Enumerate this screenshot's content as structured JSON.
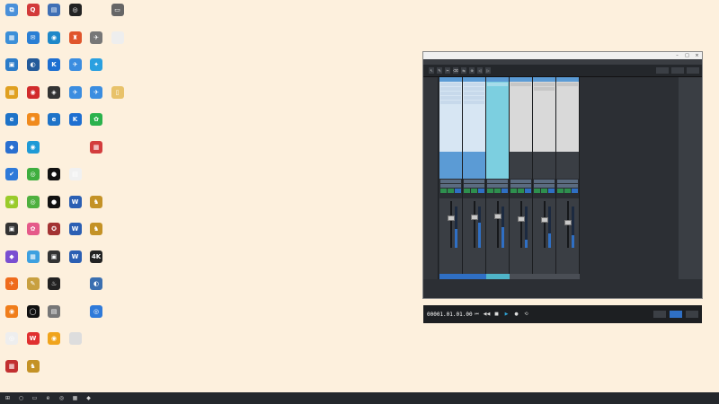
{
  "desktop": {
    "icons": [
      {
        "label": "",
        "glyph": "⧉",
        "color": "#4a90d9",
        "col": 0,
        "row": 0
      },
      {
        "label": "",
        "glyph": "Q",
        "color": "#d23a3a",
        "col": 1,
        "row": 0
      },
      {
        "label": "",
        "glyph": "▤",
        "color": "#3f6fb5",
        "col": 2,
        "row": 0
      },
      {
        "label": "",
        "glyph": "◎",
        "color": "#222222",
        "col": 3,
        "row": 0
      },
      {
        "label": "",
        "glyph": "▭",
        "color": "#666666",
        "col": 5,
        "row": 0
      },
      {
        "label": "",
        "glyph": "▦",
        "color": "#3c8fd8",
        "col": 0,
        "row": 1
      },
      {
        "label": "",
        "glyph": "✉",
        "color": "#2a7fd4",
        "col": 1,
        "row": 1
      },
      {
        "label": "",
        "glyph": "◉",
        "color": "#1e88c9",
        "col": 2,
        "row": 1
      },
      {
        "label": "",
        "glyph": "♜",
        "color": "#e0552b",
        "col": 3,
        "row": 1
      },
      {
        "label": "",
        "glyph": "✈",
        "color": "#777777",
        "col": 4,
        "row": 1
      },
      {
        "label": "",
        "glyph": "",
        "color": "#eeeeee",
        "col": 5,
        "row": 1
      },
      {
        "label": "",
        "glyph": "▣",
        "color": "#2b7cc9",
        "col": 0,
        "row": 2
      },
      {
        "label": "",
        "glyph": "◐",
        "color": "#235a9a",
        "col": 1,
        "row": 2
      },
      {
        "label": "",
        "glyph": "K",
        "color": "#1e6fd1",
        "col": 2,
        "row": 2
      },
      {
        "label": "",
        "glyph": "✈",
        "color": "#3b8de0",
        "col": 3,
        "row": 2
      },
      {
        "label": "",
        "glyph": "✦",
        "color": "#2aa0e0",
        "col": 4,
        "row": 2
      },
      {
        "label": "",
        "glyph": "▦",
        "color": "#e0a020",
        "col": 0,
        "row": 3
      },
      {
        "label": "",
        "glyph": "◉",
        "color": "#d12b2b",
        "col": 1,
        "row": 3
      },
      {
        "label": "",
        "glyph": "◈",
        "color": "#333333",
        "col": 2,
        "row": 3
      },
      {
        "label": "",
        "glyph": "✈",
        "color": "#3b8de0",
        "col": 3,
        "row": 3
      },
      {
        "label": "",
        "glyph": "✈",
        "color": "#3b8de0",
        "col": 4,
        "row": 3
      },
      {
        "label": "",
        "glyph": "▯",
        "color": "#e8c26a",
        "col": 5,
        "row": 3
      },
      {
        "label": "",
        "glyph": "e",
        "color": "#1e73c8",
        "col": 0,
        "row": 4
      },
      {
        "label": "",
        "glyph": "✺",
        "color": "#f08a1d",
        "col": 1,
        "row": 4
      },
      {
        "label": "",
        "glyph": "e",
        "color": "#1e73c8",
        "col": 2,
        "row": 4
      },
      {
        "label": "",
        "glyph": "K",
        "color": "#1e6fd1",
        "col": 3,
        "row": 4
      },
      {
        "label": "",
        "glyph": "✿",
        "color": "#2bb24c",
        "col": 4,
        "row": 4
      },
      {
        "label": "",
        "glyph": "◆",
        "color": "#2a6fd0",
        "col": 0,
        "row": 5
      },
      {
        "label": "",
        "glyph": "◉",
        "color": "#1f9ad6",
        "col": 1,
        "row": 5
      },
      {
        "label": "",
        "glyph": "▦",
        "color": "#d33d3d",
        "col": 4,
        "row": 5
      },
      {
        "label": "",
        "glyph": "✔",
        "color": "#2f7ad9",
        "col": 0,
        "row": 6
      },
      {
        "label": "",
        "glyph": "◎",
        "color": "#3fae3f",
        "col": 1,
        "row": 6
      },
      {
        "label": "",
        "glyph": "●",
        "color": "#111111",
        "col": 2,
        "row": 6
      },
      {
        "label": "",
        "glyph": "▤",
        "color": "#f1f1f1",
        "col": 3,
        "row": 6
      },
      {
        "label": "",
        "glyph": "◉",
        "color": "#9acb2a",
        "col": 0,
        "row": 7
      },
      {
        "label": "",
        "glyph": "◎",
        "color": "#4fb03f",
        "col": 1,
        "row": 7
      },
      {
        "label": "",
        "glyph": "●",
        "color": "#111111",
        "col": 2,
        "row": 7
      },
      {
        "label": "",
        "glyph": "W",
        "color": "#2b5fb3",
        "col": 3,
        "row": 7
      },
      {
        "label": "",
        "glyph": "♞",
        "color": "#c49226",
        "col": 4,
        "row": 7
      },
      {
        "label": "",
        "glyph": "▣",
        "color": "#333333",
        "col": 0,
        "row": 8
      },
      {
        "label": "",
        "glyph": "✿",
        "color": "#e55a8a",
        "col": 1,
        "row": 8
      },
      {
        "label": "",
        "glyph": "✪",
        "color": "#a33333",
        "col": 2,
        "row": 8
      },
      {
        "label": "",
        "glyph": "W",
        "color": "#2b5fb3",
        "col": 3,
        "row": 8
      },
      {
        "label": "",
        "glyph": "♞",
        "color": "#c49226",
        "col": 4,
        "row": 8
      },
      {
        "label": "",
        "glyph": "◆",
        "color": "#7a4fd1",
        "col": 0,
        "row": 9
      },
      {
        "label": "",
        "glyph": "▦",
        "color": "#3da0e0",
        "col": 1,
        "row": 9
      },
      {
        "label": "",
        "glyph": "▣",
        "color": "#333333",
        "col": 2,
        "row": 9
      },
      {
        "label": "",
        "glyph": "W",
        "color": "#2b5fb3",
        "col": 3,
        "row": 9
      },
      {
        "label": "",
        "glyph": "4K",
        "color": "#222222",
        "col": 4,
        "row": 9
      },
      {
        "label": "",
        "glyph": "✈",
        "color": "#ef6b1c",
        "col": 0,
        "row": 10
      },
      {
        "label": "",
        "glyph": "✎",
        "color": "#c8a040",
        "col": 1,
        "row": 10
      },
      {
        "label": "",
        "glyph": "♨",
        "color": "#222222",
        "col": 2,
        "row": 10
      },
      {
        "label": "",
        "glyph": "◐",
        "color": "#3b6fb0",
        "col": 4,
        "row": 10
      },
      {
        "label": "",
        "glyph": "◉",
        "color": "#f07d1a",
        "col": 0,
        "row": 11
      },
      {
        "label": "",
        "glyph": "◯",
        "color": "#111111",
        "col": 1,
        "row": 11
      },
      {
        "label": "",
        "glyph": "▤",
        "color": "#777777",
        "col": 2,
        "row": 11
      },
      {
        "label": "",
        "glyph": "◎",
        "color": "#2f7ad9",
        "col": 4,
        "row": 11
      },
      {
        "label": "",
        "glyph": "◎",
        "color": "#eeeeee",
        "col": 0,
        "row": 12
      },
      {
        "label": "",
        "glyph": "W",
        "color": "#e03030",
        "col": 1,
        "row": 12
      },
      {
        "label": "",
        "glyph": "◉",
        "color": "#f0a41c",
        "col": 2,
        "row": 12
      },
      {
        "label": "",
        "glyph": "",
        "color": "#dddddd",
        "col": 3,
        "row": 12
      },
      {
        "label": "",
        "glyph": "▦",
        "color": "#c23030",
        "col": 0,
        "row": 13
      },
      {
        "label": "",
        "glyph": "♞",
        "color": "#c49226",
        "col": 1,
        "row": 13
      }
    ]
  },
  "watermark": {
    "big": "",
    "small": ""
  },
  "window": {
    "title": "",
    "menu": [
      "",
      "",
      "",
      "",
      "",
      "",
      "",
      "",
      "",
      ""
    ],
    "toolbar": {
      "label": "",
      "buttons": [
        "↖",
        "✎",
        "✂",
        "⌫",
        "⇆",
        "⊕",
        "◁",
        "▷"
      ],
      "right_buttons": [
        "",
        "",
        ""
      ]
    },
    "strips": [
      {
        "inserts": [
          "",
          "",
          "",
          "",
          ""
        ],
        "io": [
          "",
          ""
        ],
        "name": "",
        "level": 0.45,
        "fader": 0.35,
        "theme": "blue"
      },
      {
        "inserts": [
          "",
          "",
          "",
          "",
          ""
        ],
        "io": [
          "",
          ""
        ],
        "name": "",
        "level": 0.6,
        "fader": 0.32,
        "theme": "blue"
      },
      {
        "inserts": [
          ""
        ],
        "io": [
          "",
          ""
        ],
        "name": "",
        "level": 0.5,
        "fader": 0.3,
        "theme": "cyan"
      },
      {
        "inserts": [
          ""
        ],
        "io": [
          "",
          ""
        ],
        "name": "",
        "level": 0.2,
        "fader": 0.38,
        "theme": "gray"
      },
      {
        "inserts": [
          "",
          ""
        ],
        "io": [
          "",
          ""
        ],
        "name": "",
        "level": 0.35,
        "fader": 0.4,
        "theme": "gray"
      },
      {
        "inserts": [
          ""
        ],
        "io": [
          "",
          ""
        ],
        "name": "",
        "level": 0.3,
        "fader": 0.45,
        "theme": "gray"
      }
    ],
    "transport": {
      "time": "00001.01.01.00",
      "buttons": [
        "⏮",
        "◀◀",
        "■",
        "▶",
        "●",
        "⟲"
      ],
      "info": "",
      "tabs": [
        "",
        "",
        ""
      ]
    }
  },
  "taskbar": {
    "items": [
      "⊞",
      "○",
      "▭",
      "e",
      "◎",
      "▦",
      "◆"
    ],
    "tray": [
      "",
      ""
    ]
  }
}
